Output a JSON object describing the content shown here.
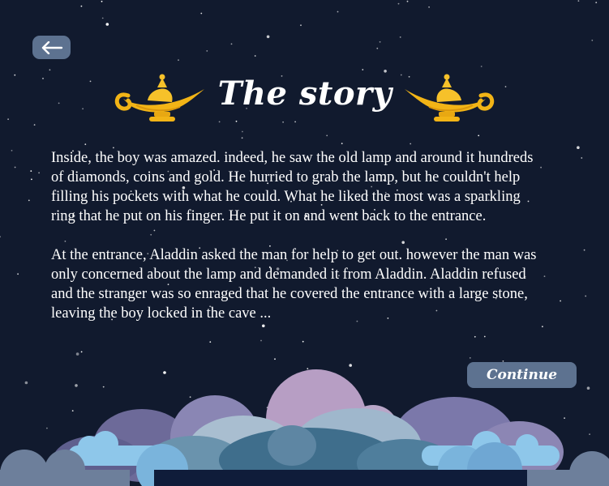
{
  "header": {
    "back_icon": "arrow-left-icon",
    "title": "The story",
    "lamp_icon": "magic-lamp-icon"
  },
  "story": {
    "paragraphs": [
      "Inside, the boy was amazed. indeed, he saw the old lamp and around it hun­dreds of diamonds, coins and gold. He hurried to grab the lamp, but he couldn't help filling his pockets with what he could. What he liked the most was a sparkling ring that he put on his finger. He put it on and went back to the entrance.",
      "At the entrance, Aladdin asked the man for help to get out. however the man was only concerned about the lamp and demanded it from Aladdin. Aladdin refused and the stranger was so enraged that he covered the entrance with a large stone, leaving the boy locked in the cave ..."
    ]
  },
  "actions": {
    "continue_label": "Continue"
  },
  "colors": {
    "background": "#111a2e",
    "button": "#5d7290",
    "lamp_gold": "#f2b416"
  }
}
